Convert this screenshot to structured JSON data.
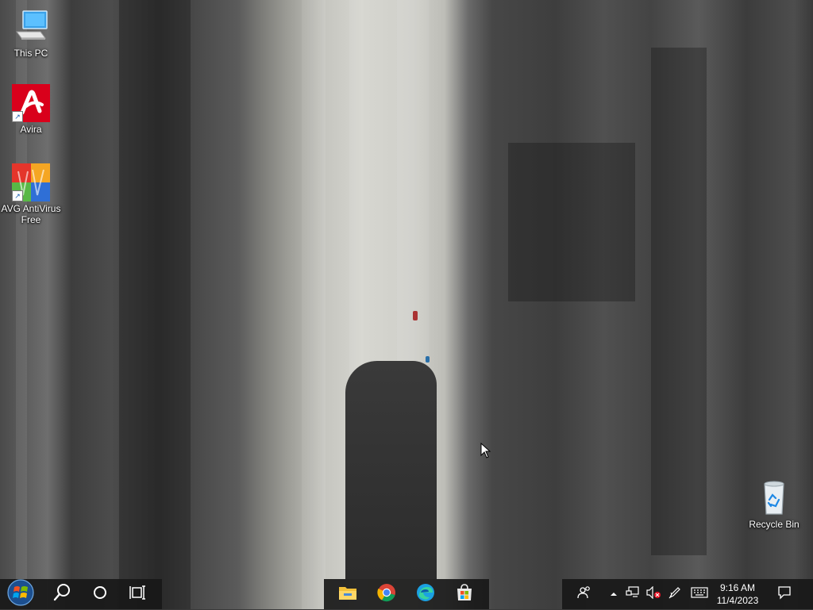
{
  "desktop": {
    "icons": [
      {
        "label": "This PC",
        "icon": "this-pc-icon"
      },
      {
        "label": "Avira",
        "icon": "avira-icon"
      },
      {
        "label": "AVG AntiVirus Free",
        "icon": "avg-antivirus-icon"
      },
      {
        "label": "Recycle Bin",
        "icon": "recycle-bin-icon"
      }
    ]
  },
  "taskbar": {
    "left": [
      "start-icon",
      "search-icon",
      "cortana-icon",
      "task-view-icon"
    ],
    "pinned": [
      "file-explorer-icon",
      "chrome-icon",
      "edge-icon",
      "microsoft-store-icon"
    ],
    "tray": [
      "people-icon",
      "show-hidden-icons-chevron",
      "network-icon",
      "volume-muted-icon",
      "pen-workspace-icon",
      "touch-keyboard-icon"
    ],
    "clock": {
      "time": "9:16 AM",
      "date": "11/4/2023"
    },
    "notification_icon": "action-center-icon"
  },
  "colors": {
    "taskbar_bg": "#181818",
    "avira_red": "#d9001b",
    "store_blue": "#0078d4"
  }
}
